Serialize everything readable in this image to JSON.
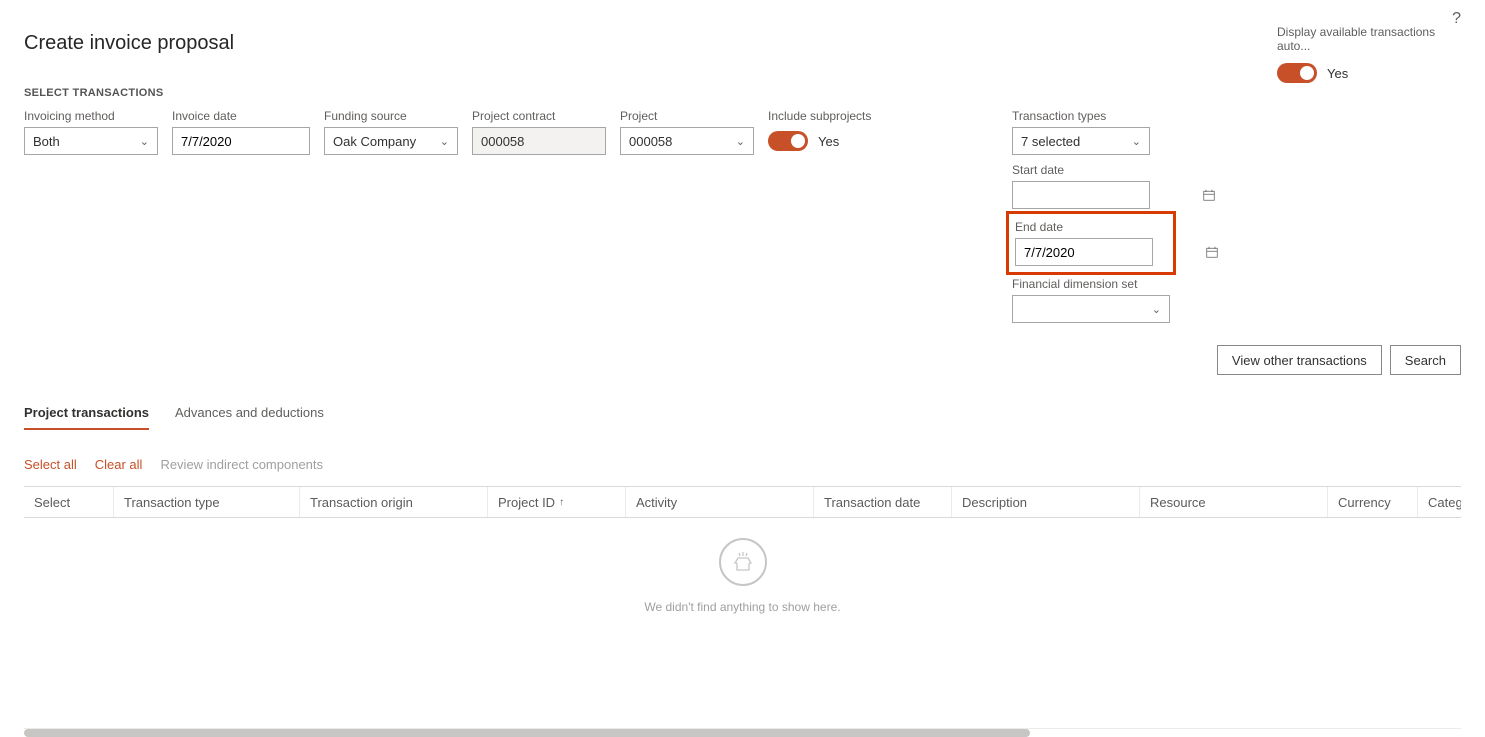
{
  "header": {
    "helpIcon": "?"
  },
  "title": "Create invoice proposal",
  "autoDisplay": {
    "label": "Display available transactions auto...",
    "value": "Yes"
  },
  "section": "SELECT TRANSACTIONS",
  "filters": {
    "invoicingMethod": {
      "label": "Invoicing method",
      "value": "Both"
    },
    "invoiceDate": {
      "label": "Invoice date",
      "value": "7/7/2020"
    },
    "fundingSource": {
      "label": "Funding source",
      "value": "Oak Company"
    },
    "projectContract": {
      "label": "Project contract",
      "value": "000058"
    },
    "project": {
      "label": "Project",
      "value": "000058"
    },
    "includeSubprojects": {
      "label": "Include subprojects",
      "value": "Yes"
    },
    "transactionTypes": {
      "label": "Transaction types",
      "value": "7 selected"
    },
    "startDate": {
      "label": "Start date",
      "value": ""
    },
    "endDate": {
      "label": "End date",
      "value": "7/7/2020"
    },
    "financialDimensionSet": {
      "label": "Financial dimension set",
      "value": ""
    }
  },
  "actions": {
    "viewOther": "View other transactions",
    "search": "Search"
  },
  "tabs": {
    "project": "Project transactions",
    "advances": "Advances and deductions"
  },
  "subactions": {
    "selectAll": "Select all",
    "clearAll": "Clear all",
    "reviewIndirect": "Review indirect components"
  },
  "tableHeaders": {
    "select": "Select",
    "txnType": "Transaction type",
    "origin": "Transaction origin",
    "projectId": "Project ID",
    "activity": "Activity",
    "txnDate": "Transaction date",
    "description": "Description",
    "resource": "Resource",
    "currency": "Currency",
    "category": "Category"
  },
  "sortIndicator": "↑",
  "emptyState": "We didn't find anything to show here."
}
